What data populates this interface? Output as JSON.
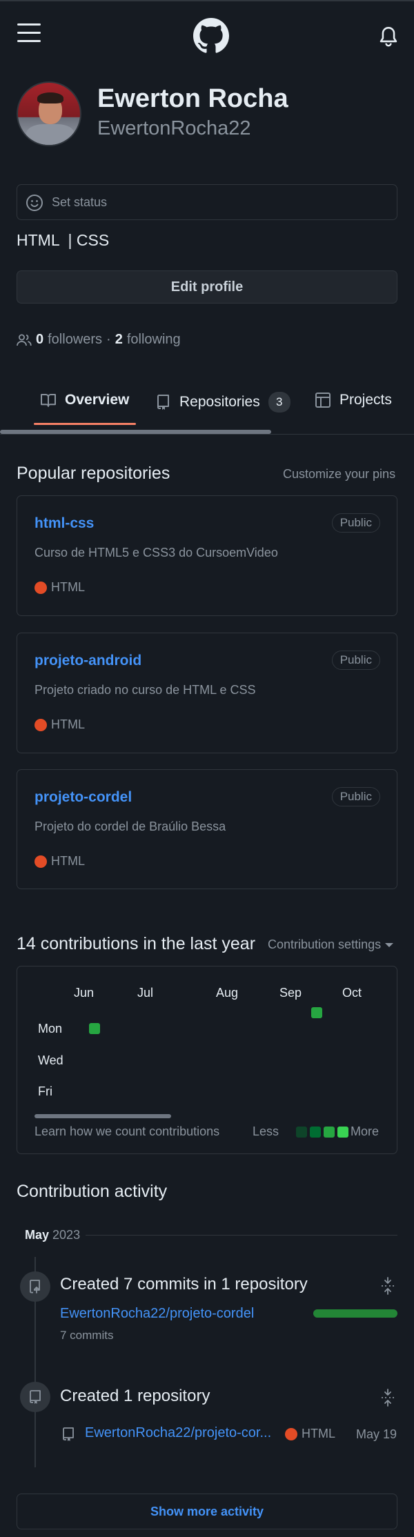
{
  "header": {
    "menu_icon": "hamburger-icon",
    "logo_icon": "github-mark-icon",
    "notifications_icon": "bell-icon"
  },
  "profile": {
    "name": "Ewerton Rocha",
    "login": "EwertonRocha22",
    "status_placeholder": "Set status",
    "bio": "HTML  | CSS",
    "edit_button": "Edit profile",
    "followers_count": "0",
    "followers_label": "followers",
    "separator": "·",
    "following_count": "2",
    "following_label": "following"
  },
  "tabs": [
    {
      "label": "Overview",
      "icon": "book-icon",
      "selected": true
    },
    {
      "label": "Repositories",
      "icon": "repo-icon",
      "counter": "3"
    },
    {
      "label": "Projects",
      "icon": "table-icon"
    }
  ],
  "pins": {
    "title": "Popular repositories",
    "customize": "Customize your pins",
    "items": [
      {
        "name": "html-css",
        "visibility": "Public",
        "description": "Curso de HTML5 e CSS3 do CursoemVideo",
        "language": "HTML",
        "language_color": "#e34c26"
      },
      {
        "name": "projeto-android",
        "visibility": "Public",
        "description": "Projeto criado no curso de HTML e CSS",
        "language": "HTML",
        "language_color": "#e34c26"
      },
      {
        "name": "projeto-cordel",
        "visibility": "Public",
        "description": "Projeto do cordel de Braúlio Bessa",
        "language": "HTML",
        "language_color": "#e34c26"
      }
    ]
  },
  "contributions": {
    "title": "14 contributions in the last year",
    "settings": "Contribution settings",
    "months": [
      "Jun",
      "Jul",
      "Aug",
      "Sep",
      "Oct"
    ],
    "days": [
      "Mon",
      "Wed",
      "Fri"
    ],
    "learn": "Learn how we count contributions",
    "less": "Less",
    "more": "More",
    "legend_colors": [
      "#0e4429",
      "#006d32",
      "#26a641",
      "#39d353"
    ]
  },
  "activity": {
    "title": "Contribution activity",
    "month": "May",
    "year": "2023",
    "items": [
      {
        "heading": "Created 7 commits in 1 repository",
        "icon": "repo-push-icon",
        "repo": "EwertonRocha22/projeto-cordel",
        "sub": "7 commits",
        "progress": 1.0
      },
      {
        "heading": "Created 1 repository",
        "icon": "repo-icon",
        "repo": "EwertonRocha22/projeto-cor...",
        "language": "HTML",
        "date": "May 19"
      }
    ],
    "show_more": "Show more activity"
  },
  "colors": {
    "background": "#161b22",
    "link": "#4493f8",
    "accent_tab": "#f78166",
    "green": "#26a641"
  }
}
